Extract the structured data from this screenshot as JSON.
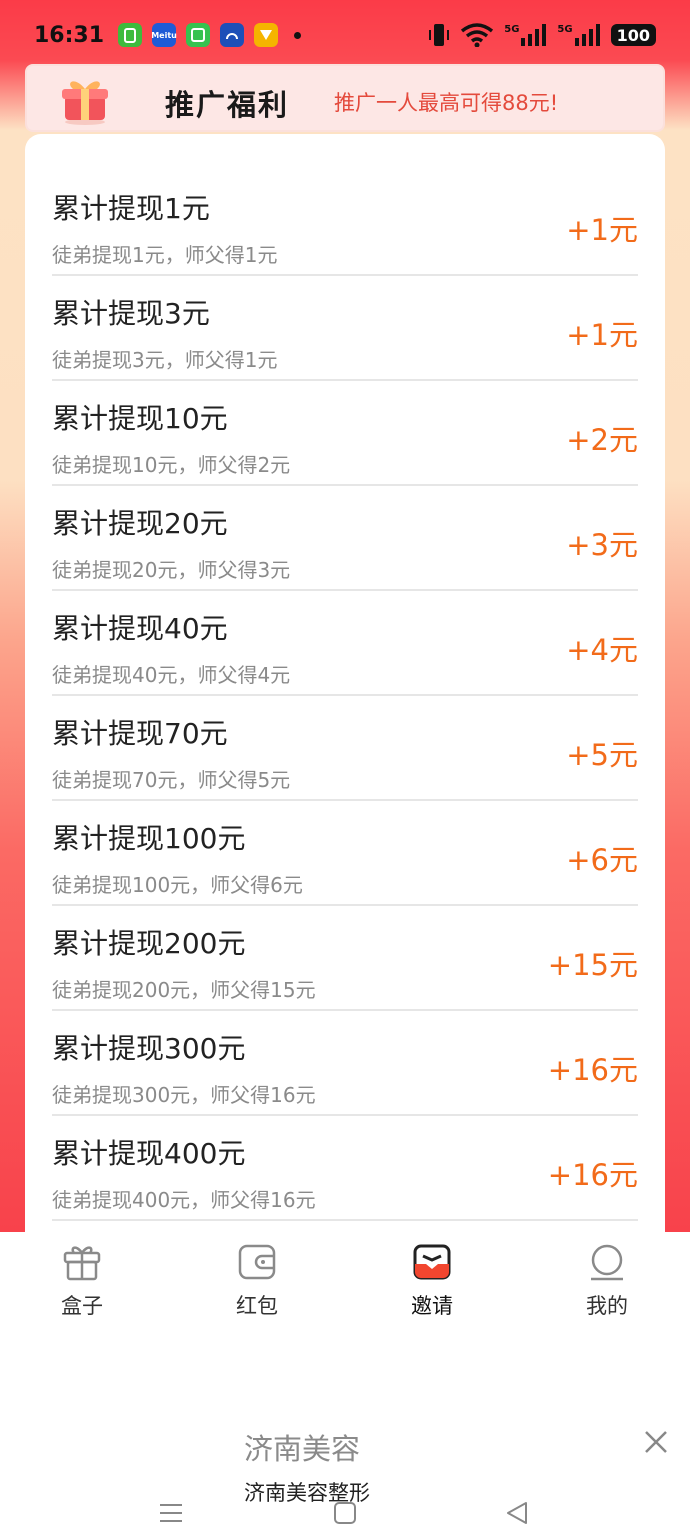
{
  "status_bar": {
    "time": "16:31",
    "apps": [
      {
        "name": "green-app-icon",
        "color": "#3dbb3d",
        "text": ""
      },
      {
        "name": "meituan-app-icon",
        "color": "#1f5bd6",
        "text": "Meitu"
      },
      {
        "name": "green-grid-app-icon",
        "color": "#36c24f",
        "text": ""
      },
      {
        "name": "blue-app-icon",
        "color": "#1d4fb8",
        "text": ""
      },
      {
        "name": "yellow-app-icon",
        "color": "#f5b400",
        "text": ""
      }
    ],
    "network_1": "5G",
    "network_2": "5G",
    "battery": "100"
  },
  "banner": {
    "title": "推广福利",
    "subtitle": "推广一人最高可得88元!"
  },
  "rewards": [
    {
      "title": "累计提现1元",
      "desc": "徒弟提现1元，师父得1元",
      "reward": "+1元"
    },
    {
      "title": "累计提现3元",
      "desc": "徒弟提现3元，师父得1元",
      "reward": "+1元"
    },
    {
      "title": "累计提现10元",
      "desc": "徒弟提现10元，师父得2元",
      "reward": "+2元"
    },
    {
      "title": "累计提现20元",
      "desc": "徒弟提现20元，师父得3元",
      "reward": "+3元"
    },
    {
      "title": "累计提现40元",
      "desc": "徒弟提现40元，师父得4元",
      "reward": "+4元"
    },
    {
      "title": "累计提现70元",
      "desc": "徒弟提现70元，师父得5元",
      "reward": "+5元"
    },
    {
      "title": "累计提现100元",
      "desc": "徒弟提现100元，师父得6元",
      "reward": "+6元"
    },
    {
      "title": "累计提现200元",
      "desc": "徒弟提现200元，师父得15元",
      "reward": "+15元"
    },
    {
      "title": "累计提现300元",
      "desc": "徒弟提现300元，师父得16元",
      "reward": "+16元"
    },
    {
      "title": "累计提现400元",
      "desc": "徒弟提现400元，师父得16元",
      "reward": "+16元"
    }
  ],
  "tabs": [
    {
      "label": "盒子",
      "icon": "gift-box-icon",
      "active": false
    },
    {
      "label": "红包",
      "icon": "wallet-icon",
      "active": false
    },
    {
      "label": "邀请",
      "icon": "invite-envelope-icon",
      "active": true
    },
    {
      "label": "我的",
      "icon": "profile-icon",
      "active": false
    }
  ],
  "ad": {
    "title": "济南美容",
    "subtitle": "济南美容整形"
  },
  "colors": {
    "accent_orange": "#f26b1a",
    "banner_subtitle": "#e44a3c",
    "header_red": "#fb3b48"
  }
}
